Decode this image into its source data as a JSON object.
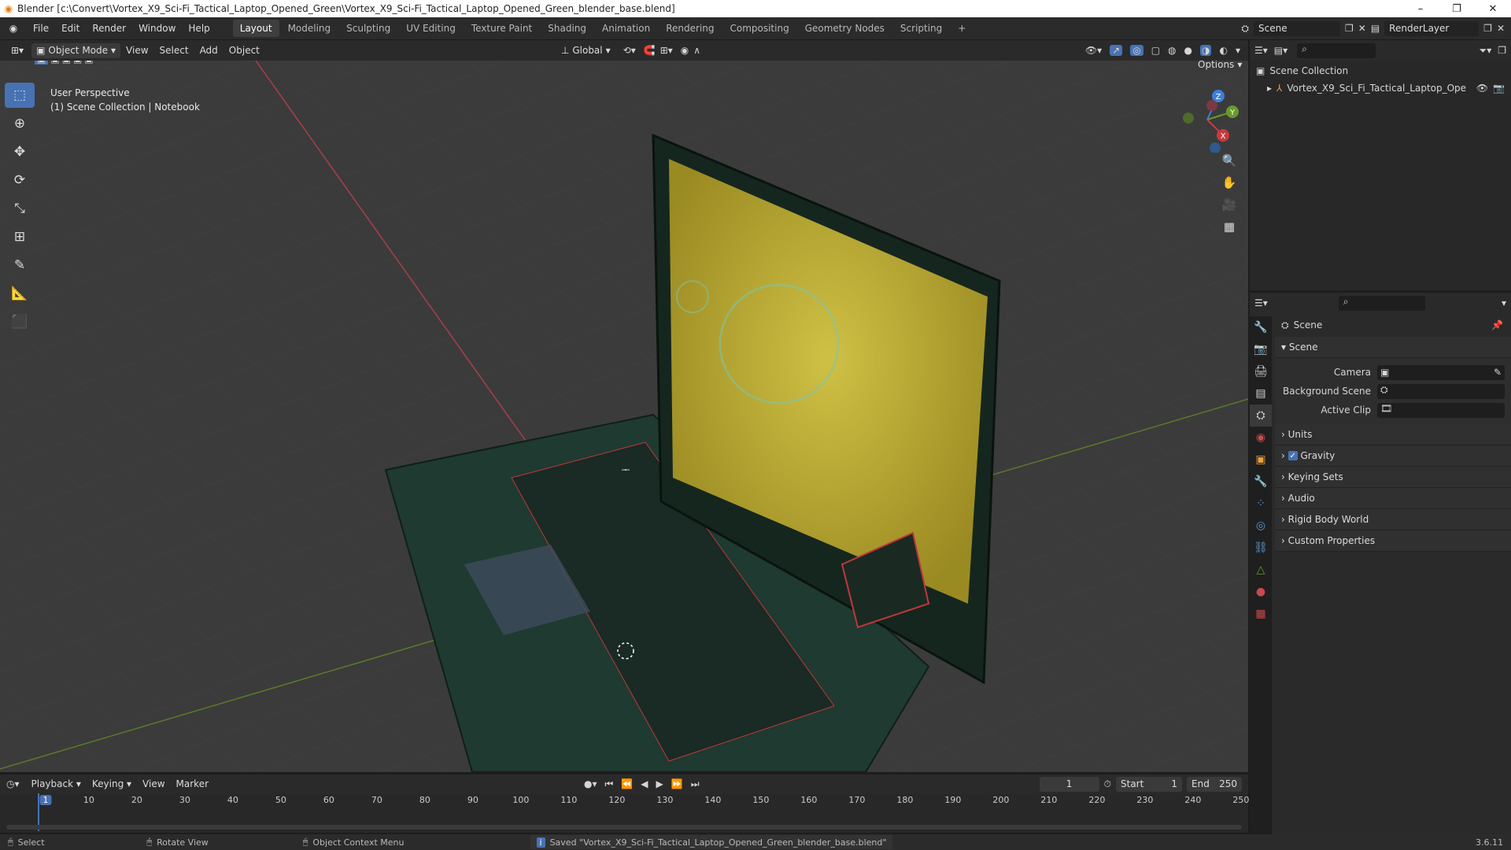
{
  "window": {
    "title": "Blender [c:\\Convert\\Vortex_X9_Sci-Fi_Tactical_Laptop_Opened_Green\\Vortex_X9_Sci-Fi_Tactical_Laptop_Opened_Green_blender_base.blend]",
    "minimize": "–",
    "maximize": "❐",
    "close": "✕"
  },
  "menu": [
    "File",
    "Edit",
    "Render",
    "Window",
    "Help"
  ],
  "workspaces": [
    "Layout",
    "Modeling",
    "Sculpting",
    "UV Editing",
    "Texture Paint",
    "Shading",
    "Animation",
    "Rendering",
    "Compositing",
    "Geometry Nodes",
    "Scripting",
    "+"
  ],
  "topright": {
    "scene": "Scene",
    "view_layer": "RenderLayer"
  },
  "viewport_header": {
    "mode": "Object Mode",
    "menus": [
      "View",
      "Select",
      "Add",
      "Object"
    ],
    "orientation": "Global",
    "options": "Options"
  },
  "viewport": {
    "perspective": "User Perspective",
    "collection": "(1) Scene Collection | Notebook"
  },
  "gizmo": {
    "z": "Z",
    "y": "Y",
    "x": "X"
  },
  "outliner": {
    "root": "Scene Collection",
    "item": "Vortex_X9_Sci_Fi_Tactical_Laptop_Ope"
  },
  "properties": {
    "header": "Scene",
    "section": "Scene",
    "camera_label": "Camera",
    "background_label": "Background Scene",
    "clip_label": "Active Clip",
    "panels": [
      "Units",
      "Gravity",
      "Keying Sets",
      "Audio",
      "Rigid Body World",
      "Custom Properties"
    ]
  },
  "timeline": {
    "menus": [
      "Playback",
      "Keying",
      "View",
      "Marker"
    ],
    "current_frame": "1",
    "start_label": "Start",
    "start": "1",
    "end_label": "End",
    "end": "250",
    "ticks": [
      "1",
      "10",
      "20",
      "30",
      "40",
      "50",
      "60",
      "70",
      "80",
      "90",
      "100",
      "110",
      "120",
      "130",
      "140",
      "150",
      "160",
      "170",
      "180",
      "190",
      "200",
      "210",
      "220",
      "230",
      "240",
      "250"
    ]
  },
  "status": {
    "select": "Select",
    "rotate": "Rotate View",
    "context": "Object Context Menu",
    "message": "Saved \"Vortex_X9_Sci-Fi_Tactical_Laptop_Opened_Green_blender_base.blend\"",
    "version": "3.6.11"
  },
  "colors": {
    "accent": "#4772b3",
    "x_axis": "#c8393f",
    "y_axis": "#6a9a2a",
    "z_axis": "#3d7fd9",
    "screen": "#b8a92a",
    "body": "#1f3a30"
  }
}
